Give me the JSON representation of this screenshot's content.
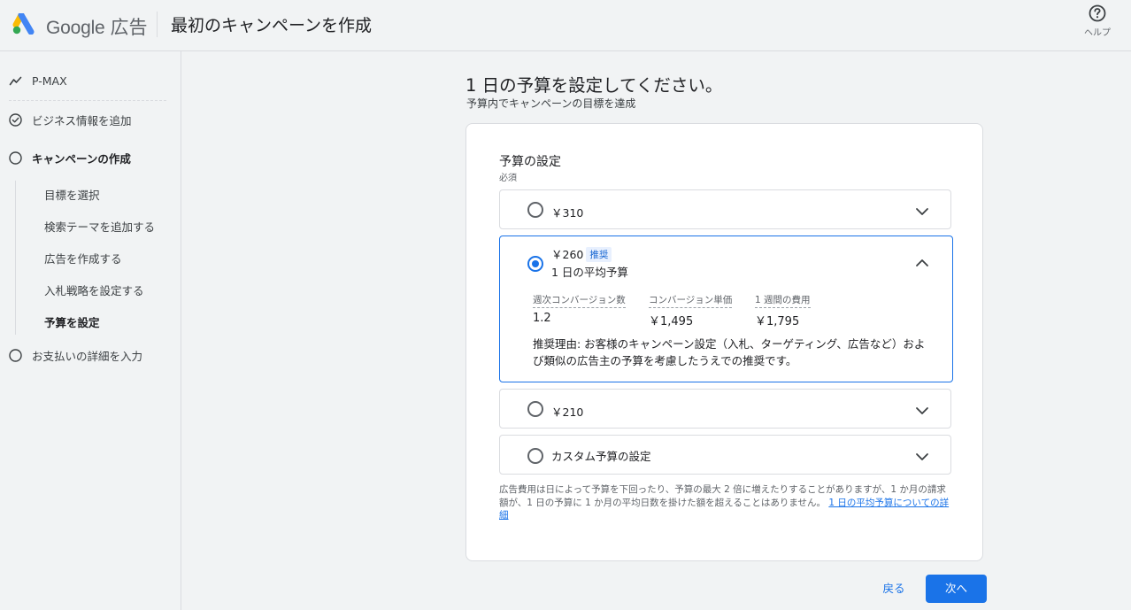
{
  "header": {
    "brand_google": "Google",
    "brand_ads": "広告",
    "title": "最初のキャンペーンを作成",
    "help_label": "ヘルプ"
  },
  "sidebar": {
    "items": [
      {
        "label": "P-MAX",
        "icon": "trend-icon"
      },
      {
        "label": "ビジネス情報を追加",
        "icon": "check-circle-icon"
      },
      {
        "label": "キャンペーンの作成",
        "icon": "circle-icon"
      },
      {
        "label": "お支払いの詳細を入力",
        "icon": "circle-icon"
      }
    ],
    "sub_items": [
      {
        "label": "目標を選択"
      },
      {
        "label": "検索テーマを追加する"
      },
      {
        "label": "広告を作成する"
      },
      {
        "label": "入札戦略を設定する"
      },
      {
        "label": "予算を設定"
      }
    ]
  },
  "main": {
    "title": "1 日の予算を設定してください。",
    "subtitle": "予算内でキャンペーンの目標を達成",
    "section_title": "予算の設定",
    "required": "必須",
    "options": [
      {
        "label": "￥310",
        "selected": false
      },
      {
        "label": "￥260",
        "badge": "推奨",
        "selected": true,
        "avg_label": "1 日の平均予算",
        "metrics": [
          {
            "label": "週次コンバージョン数",
            "value": "1.2"
          },
          {
            "label": "コンバージョン単価",
            "value": "￥1,495"
          },
          {
            "label": "1 週間の費用",
            "value": "￥1,795"
          }
        ],
        "reason": "推奨理由: お客様のキャンペーン設定（入札、ターゲティング、広告など）および類似の広告主の予算を考慮したうえでの推奨です。"
      },
      {
        "label": "￥210",
        "selected": false
      },
      {
        "label": "カスタム予算の設定",
        "selected": false
      }
    ],
    "footnote": "広告費用は日によって予算を下回ったり、予算の最大 2 倍に増えたりすることがありますが、1 か月の請求額が、1 日の予算に 1 か月の平均日数を掛けた額を超えることはありません。",
    "footnote_link": "1 日の平均予算についての詳細",
    "back_label": "戻る",
    "next_label": "次へ"
  },
  "colors": {
    "accent": "#1a73e8",
    "background": "#f1f3f4",
    "border": "#dadce0"
  }
}
